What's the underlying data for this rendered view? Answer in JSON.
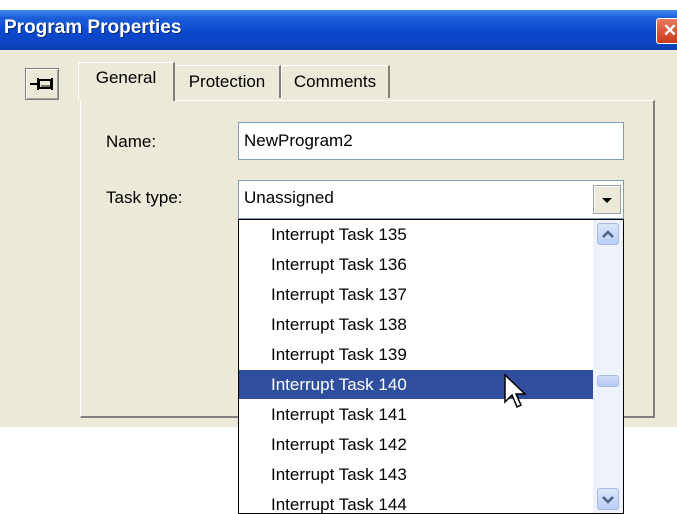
{
  "window": {
    "title": "Program Properties",
    "close_symbol": "✕"
  },
  "tabs": [
    {
      "label": "General",
      "active": true
    },
    {
      "label": "Protection",
      "active": false
    },
    {
      "label": "Comments",
      "active": false
    }
  ],
  "form": {
    "name_label": "Name:",
    "name_value": "NewProgram2",
    "task_type_label": "Task type:",
    "task_type_value": "Unassigned"
  },
  "dropdown": {
    "items": [
      {
        "label": "Interrupt Task 135",
        "selected": false
      },
      {
        "label": "Interrupt Task 136",
        "selected": false
      },
      {
        "label": "Interrupt Task 137",
        "selected": false
      },
      {
        "label": "Interrupt Task 138",
        "selected": false
      },
      {
        "label": "Interrupt Task 139",
        "selected": false
      },
      {
        "label": "Interrupt Task 140",
        "selected": true
      },
      {
        "label": "Interrupt Task 141",
        "selected": false
      },
      {
        "label": "Interrupt Task 142",
        "selected": false
      },
      {
        "label": "Interrupt Task 143",
        "selected": false
      },
      {
        "label": "Interrupt Task 144",
        "selected": false
      }
    ]
  },
  "icons": {
    "pin": "pin-icon",
    "close": "close-icon",
    "dropdown_arrow": "chevron-down-icon",
    "scroll_up": "chevron-up-icon",
    "scroll_down": "chevron-down-icon",
    "cursor": "mouse-pointer-icon"
  },
  "colors": {
    "titlebar": "#0a48cf",
    "dialog_bg": "#ece9d8",
    "selection": "#2f4f9e",
    "close_button": "#d1461f"
  }
}
